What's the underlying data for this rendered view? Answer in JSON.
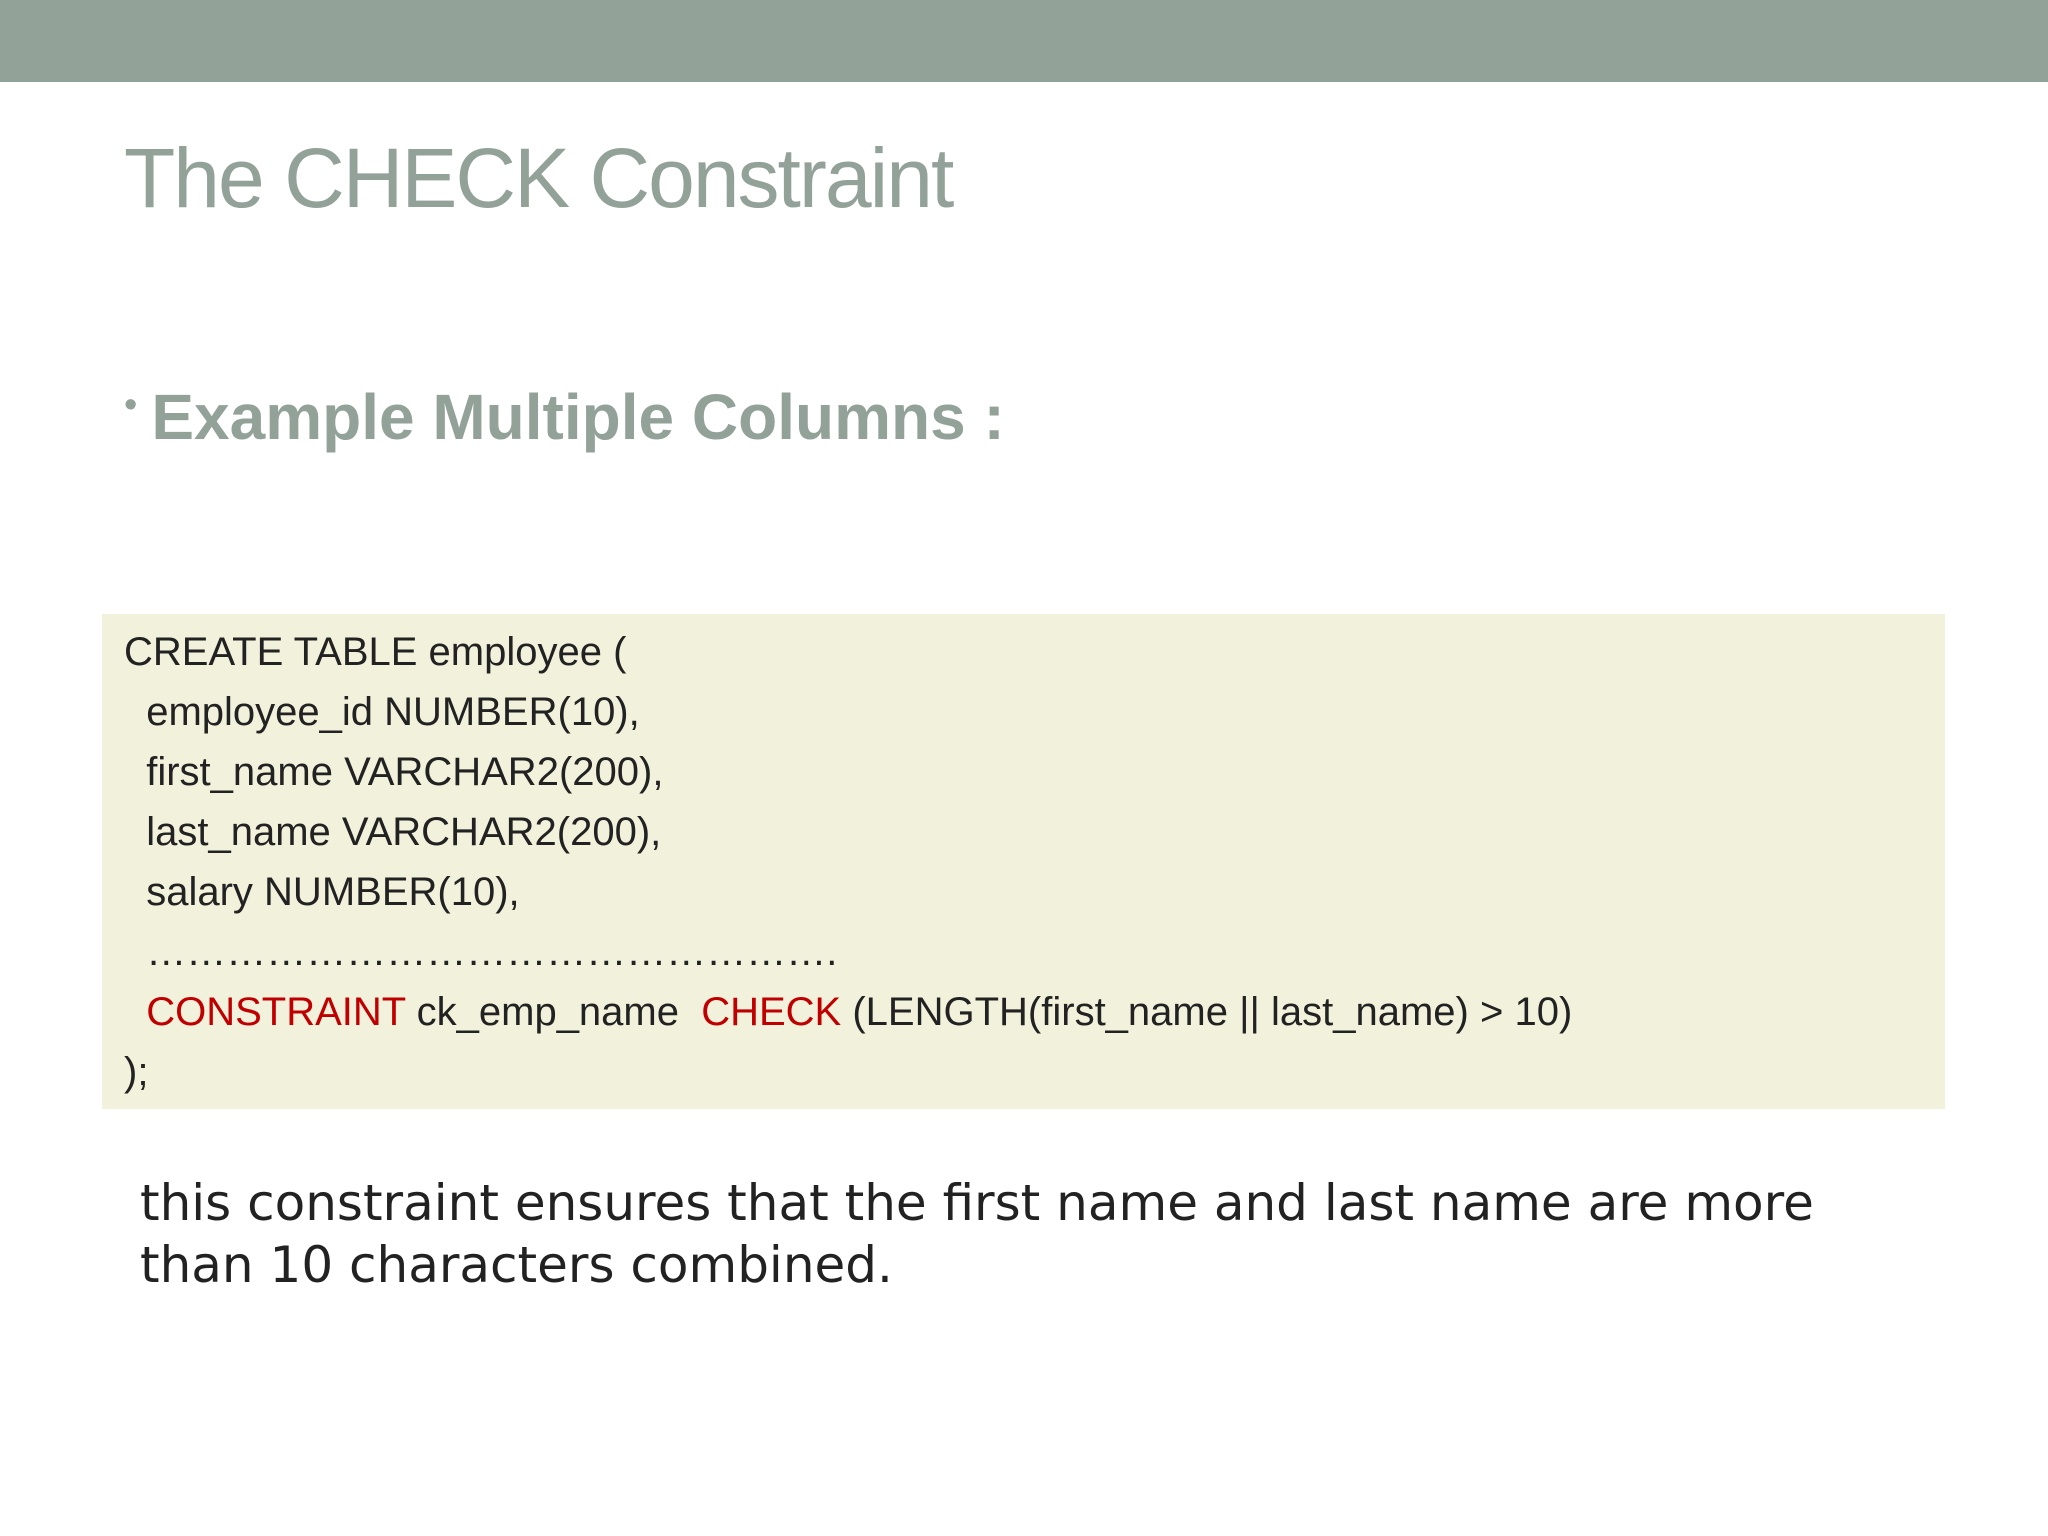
{
  "slide": {
    "title": "The CHECK Constraint",
    "bullet_marker": "•",
    "bullet": "Example Multiple Columns :",
    "caption": "this constraint ensures that the first name and last name are more than 10 characters combined."
  },
  "code": {
    "line1": "CREATE TABLE employee (",
    "line2": "  employee_id NUMBER(10),",
    "line3": "  first_name VARCHAR2(200),",
    "line4": "  last_name VARCHAR2(200),",
    "line5": "  salary NUMBER(10),",
    "line6": "  …………………………………………….",
    "line7": {
      "indent": "  ",
      "kw_constraint": "CONSTRAINT",
      "name_part": " ck_emp_name  ",
      "kw_check": "CHECK",
      "expr": " (LENGTH(first_name || last_name) > 10)"
    },
    "line8": ");"
  },
  "colors": {
    "accent": "#93a299",
    "code_background": "#f1f1dc",
    "keyword": "#c00000",
    "text": "#222222"
  }
}
